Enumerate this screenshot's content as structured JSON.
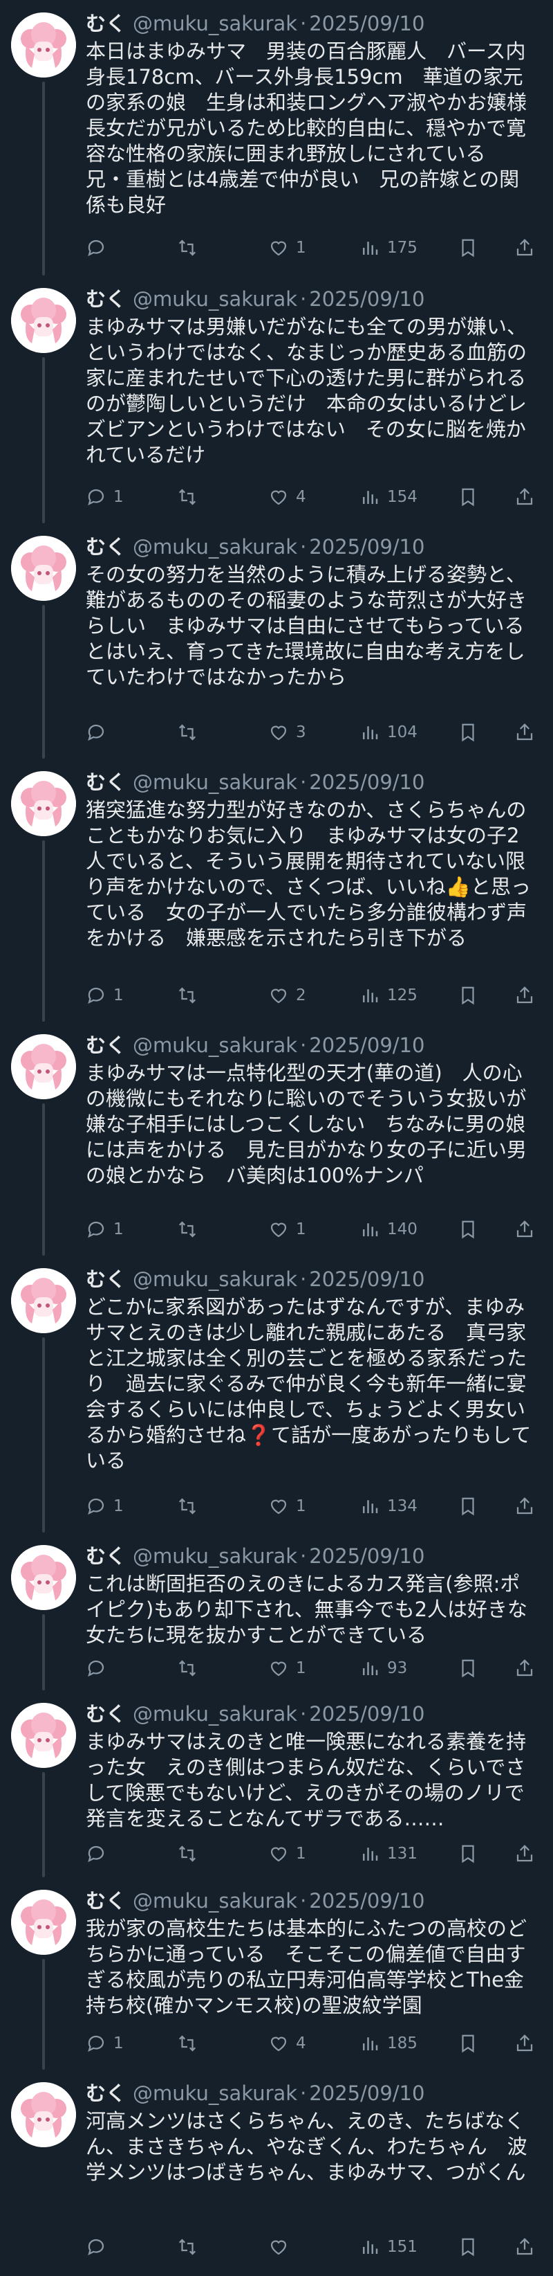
{
  "author": {
    "name": "むく",
    "handle": "@muku_sakurak",
    "separator": "·",
    "date": "2025/09/10"
  },
  "colors": {
    "background": "#15202b",
    "text": "#e7e9ea",
    "muted": "#8b98a5",
    "avatar_pink": "#f4a6bd"
  },
  "icons": {
    "reply": "reply-icon",
    "retweet": "retweet-icon",
    "like": "like-icon",
    "views": "views-icon",
    "bookmark": "bookmark-icon",
    "share": "share-icon"
  },
  "tweets": [
    {
      "text": "本日はまゆみサマ　男装の百合豚麗人　バース内身長178cm、バース外身長159cm　華道の家元の家系の娘　生身は和装ロングヘア淑やかお嬢様　長女だが兄がいるため比較的自由に、穏やかで寛容な性格の家族に囲まれ野放しにされている　兄・重樹とは4歳差で仲が良い　兄の許嫁との関係も良好",
      "replies": "",
      "retweets": "",
      "likes": "1",
      "views": "175"
    },
    {
      "text": "まゆみサマは男嫌いだがなにも全ての男が嫌い、というわけではなく、なまじっか歴史ある血筋の家に産まれたせいで下心の透けた男に群がられるのが鬱陶しいというだけ　本命の女はいるけどレズビアンというわけではない　その女に脳を焼かれているだけ",
      "replies": "1",
      "retweets": "",
      "likes": "4",
      "views": "154"
    },
    {
      "text": "その女の努力を当然のように積み上げる姿勢と、難があるもののその稲妻のような苛烈さが大好きらしい　まゆみサマは自由にさせてもらっているとはいえ、育ってきた環境故に自由な考え方をしていたわけではなかったから",
      "replies": "",
      "retweets": "",
      "likes": "3",
      "views": "104"
    },
    {
      "text_before": "猪突猛進な努力型が好きなのか、さくらちゃんのこともかなりお気に入り　まゆみサマは女の子2人でいると、そういう展開を期待されていない限り声をかけないので、さくつば、いいね",
      "emoji": "👍",
      "text_after": "と思っている　女の子が一人でいたら多分誰彼構わず声をかける　嫌悪感を示されたら引き下がる",
      "replies": "1",
      "retweets": "",
      "likes": "2",
      "views": "125"
    },
    {
      "text": "まゆみサマは一点特化型の天才(華の道)　人の心の機微にもそれなりに聡いのでそういう女扱いが嫌な子相手にはしつこくしない　ちなみに男の娘には声をかける　見た目がかなり女の子に近い男の娘とかなら　バ美肉は100%ナンパ",
      "replies": "1",
      "retweets": "",
      "likes": "1",
      "views": "140"
    },
    {
      "text_before": "どこかに家系図があったはずなんですが、まゆみサマとえのきは少し離れた親戚にあたる　真弓家と江之城家は全く別の芸ごとを極める家系だったり　過去に家ぐるみで仲が良く今も新年一緒に宴会するくらいには仲良しで、ちょうどよく男女いるから婚約させね",
      "emoji": "❓",
      "text_after": "て話が一度あがったりもしている",
      "replies": "1",
      "retweets": "",
      "likes": "1",
      "views": "134"
    },
    {
      "text": "これは断固拒否のえのきによるカス発言(参照:ポイピク)もあり却下され、無事今でも2人は好きな女たちに現を抜かすことができている",
      "replies": "",
      "retweets": "",
      "likes": "1",
      "views": "93"
    },
    {
      "text": "まゆみサマはえのきと唯一険悪になれる素養を持った女　えのき側はつまらん奴だな、くらいでさして険悪でもないけど、えのきがその場のノリで発言を変えることなんてザラである……",
      "replies": "",
      "retweets": "",
      "likes": "1",
      "views": "131"
    },
    {
      "text": "我が家の高校生たちは基本的にふたつの高校のどちらかに通っている　そこそこの偏差値で自由すぎる校風が売りの私立円寿河伯高等学校とThe金持ち校(確かマンモス校)の聖波紋学園",
      "replies": "1",
      "retweets": "",
      "likes": "4",
      "views": "185"
    },
    {
      "text": "河高メンツはさくらちゃん、えのき、たちばなくん、まさきちゃん、やなぎくん、わたちゃん　波学メンツはつばきちゃん、まゆみサマ、つがくん",
      "replies": "",
      "retweets": "",
      "likes": "",
      "views": "151"
    }
  ]
}
